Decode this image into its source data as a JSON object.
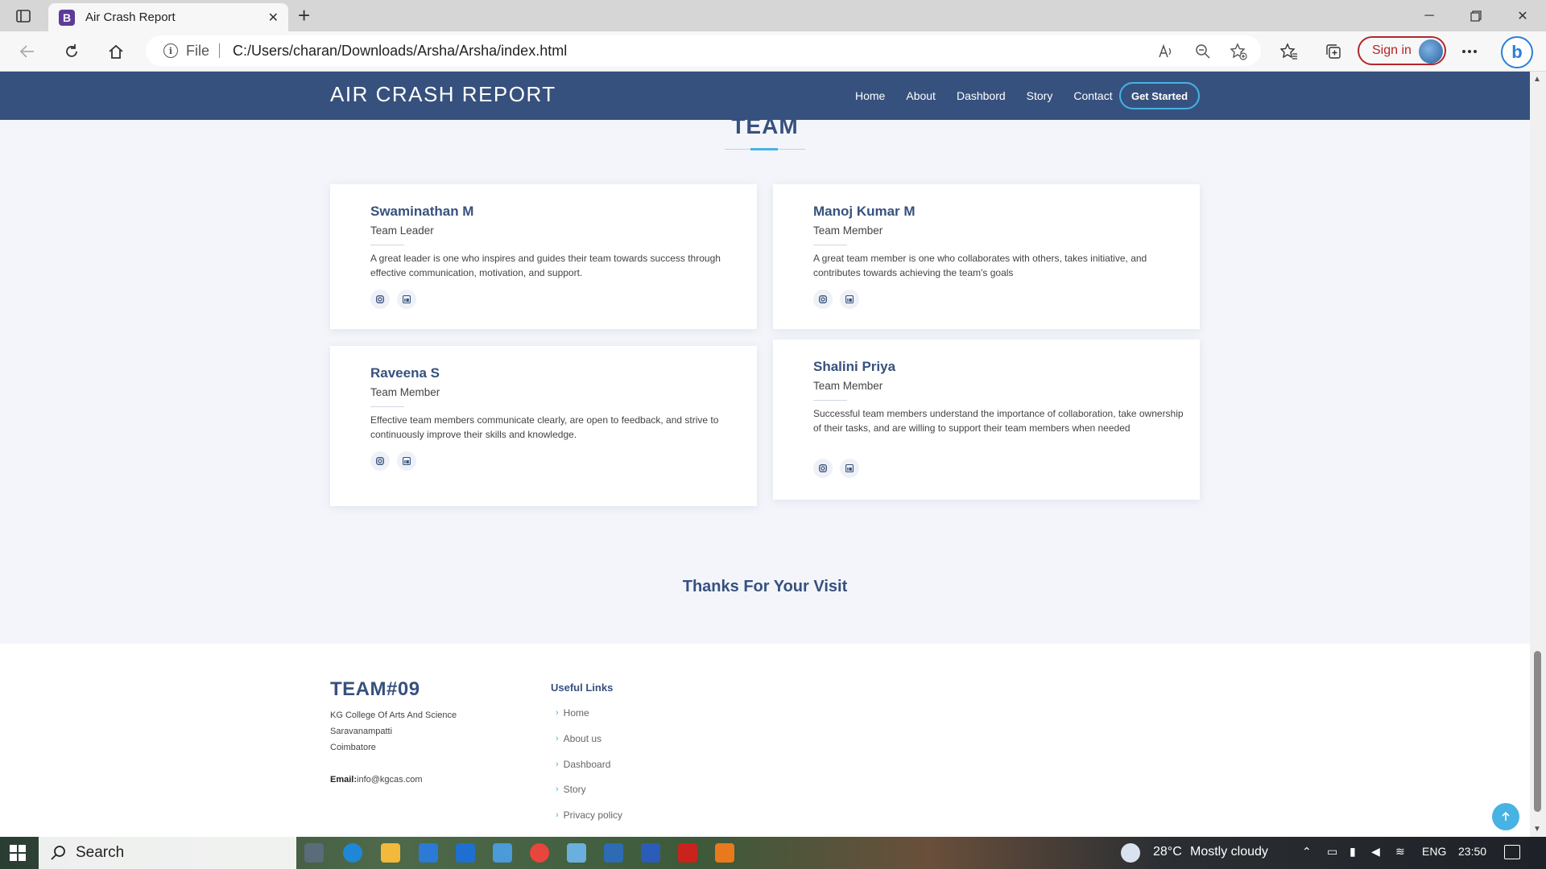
{
  "browser": {
    "tab_title": "Air Crash Report",
    "favicon_letter": "B",
    "address_label": "File",
    "url": "C:/Users/charan/Downloads/Arsha/Arsha/index.html",
    "signin_label": "Sign in"
  },
  "site": {
    "brand": "AIR CRASH REPORT",
    "nav": [
      "Home",
      "About",
      "Dashbord",
      "Story",
      "Contact"
    ],
    "cta": "Get Started"
  },
  "team": {
    "section_title": "TEAM",
    "members": [
      {
        "name": "Swaminathan M",
        "role": "Team Leader",
        "desc": "A great leader is one who inspires and guides their team towards success through effective communication, motivation, and support."
      },
      {
        "name": "Manoj Kumar M",
        "role": "Team Member",
        "desc": "A great team member is one who collaborates with others, takes initiative, and contributes towards achieving the team's goals"
      },
      {
        "name": "Raveena S",
        "role": "Team Member",
        "desc": "Effective team members communicate clearly, are open to feedback, and strive to continuously improve their skills and knowledge."
      },
      {
        "name": "Shalini Priya",
        "role": "Team Member",
        "desc": "Successful team members understand the importance of collaboration, take ownership of their tasks, and are willing to support their team members when needed"
      }
    ]
  },
  "thanks": "Thanks For Your Visit",
  "footer": {
    "brand": "TEAM#09",
    "address": [
      "KG College Of Arts And Science",
      "Saravanampatti",
      "Coimbatore"
    ],
    "email_label": "Email:",
    "email": "info@kgcas.com",
    "links_title": "Useful Links",
    "links": [
      "Home",
      "About us",
      "Dashboard",
      "Story",
      "Privacy policy"
    ]
  },
  "taskbar": {
    "search_label": "Search",
    "temperature": "28°C",
    "weather": "Mostly cloudy",
    "language": "ENG",
    "time": "23:50"
  }
}
